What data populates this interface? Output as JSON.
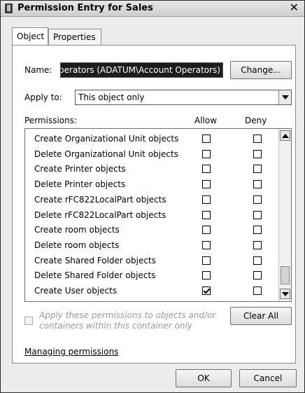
{
  "window": {
    "title": "Permission Entry for Sales",
    "close_glyph": "✕"
  },
  "tabs": [
    {
      "label": "Object"
    },
    {
      "label": "Properties"
    }
  ],
  "name": {
    "label": "Name:",
    "value": "Account Operators (ADATUM\\Account Operators)",
    "change_label": "Change..."
  },
  "apply_to": {
    "label": "Apply to:",
    "value": "This object only"
  },
  "permissions": {
    "header": "Permissions:",
    "allow_header": "Allow",
    "deny_header": "Deny",
    "rows": [
      {
        "name": "Create Organizational Unit objects",
        "allow": false,
        "deny": false
      },
      {
        "name": "Delete Organizational Unit objects",
        "allow": false,
        "deny": false
      },
      {
        "name": "Create Printer objects",
        "allow": false,
        "deny": false
      },
      {
        "name": "Delete Printer objects",
        "allow": false,
        "deny": false
      },
      {
        "name": "Create rFC822LocalPart objects",
        "allow": false,
        "deny": false
      },
      {
        "name": "Delete rFC822LocalPart objects",
        "allow": false,
        "deny": false
      },
      {
        "name": "Create room objects",
        "allow": false,
        "deny": false
      },
      {
        "name": "Delete room objects",
        "allow": false,
        "deny": false
      },
      {
        "name": "Create Shared Folder objects",
        "allow": false,
        "deny": false
      },
      {
        "name": "Delete Shared Folder objects",
        "allow": false,
        "deny": false
      },
      {
        "name": "Create User objects",
        "allow": true,
        "deny": false
      }
    ]
  },
  "apply_containers": {
    "text": "Apply these permissions to objects and/or containers within this container only"
  },
  "clear_all_label": "Clear All",
  "managing_link": "Managing permissions",
  "footer": {
    "ok_label": "OK",
    "cancel_label": "Cancel"
  }
}
